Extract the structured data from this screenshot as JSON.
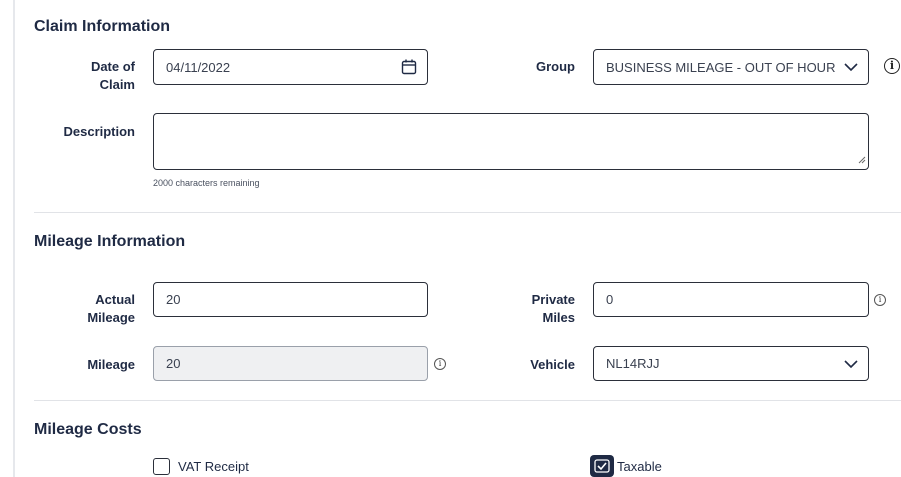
{
  "claim_info": {
    "title": "Claim Information",
    "date_label_line1": "Date of",
    "date_label_line2": "Claim",
    "date_value": "04/11/2022",
    "group_label": "Group",
    "group_value": "BUSINESS MILEAGE - OUT OF HOUR",
    "description_label": "Description",
    "description_value": "",
    "description_hint": "2000 characters remaining"
  },
  "mileage_info": {
    "title": "Mileage Information",
    "actual_label_line1": "Actual",
    "actual_label_line2": "Mileage",
    "actual_value": "20",
    "private_label_line1": "Private",
    "private_label_line2": "Miles",
    "private_value": "0",
    "mileage_label": "Mileage",
    "mileage_value": "20",
    "vehicle_label": "Vehicle",
    "vehicle_value": "NL14RJJ"
  },
  "mileage_costs": {
    "title": "Mileage Costs",
    "vat_receipt_label": "VAT Receipt",
    "vat_receipt_checked": false,
    "taxable_label": "Taxable",
    "taxable_checked": true
  },
  "icons": {
    "info_glyph": "i",
    "calendar": "calendar-icon",
    "chevron": "chevron-down-icon"
  }
}
